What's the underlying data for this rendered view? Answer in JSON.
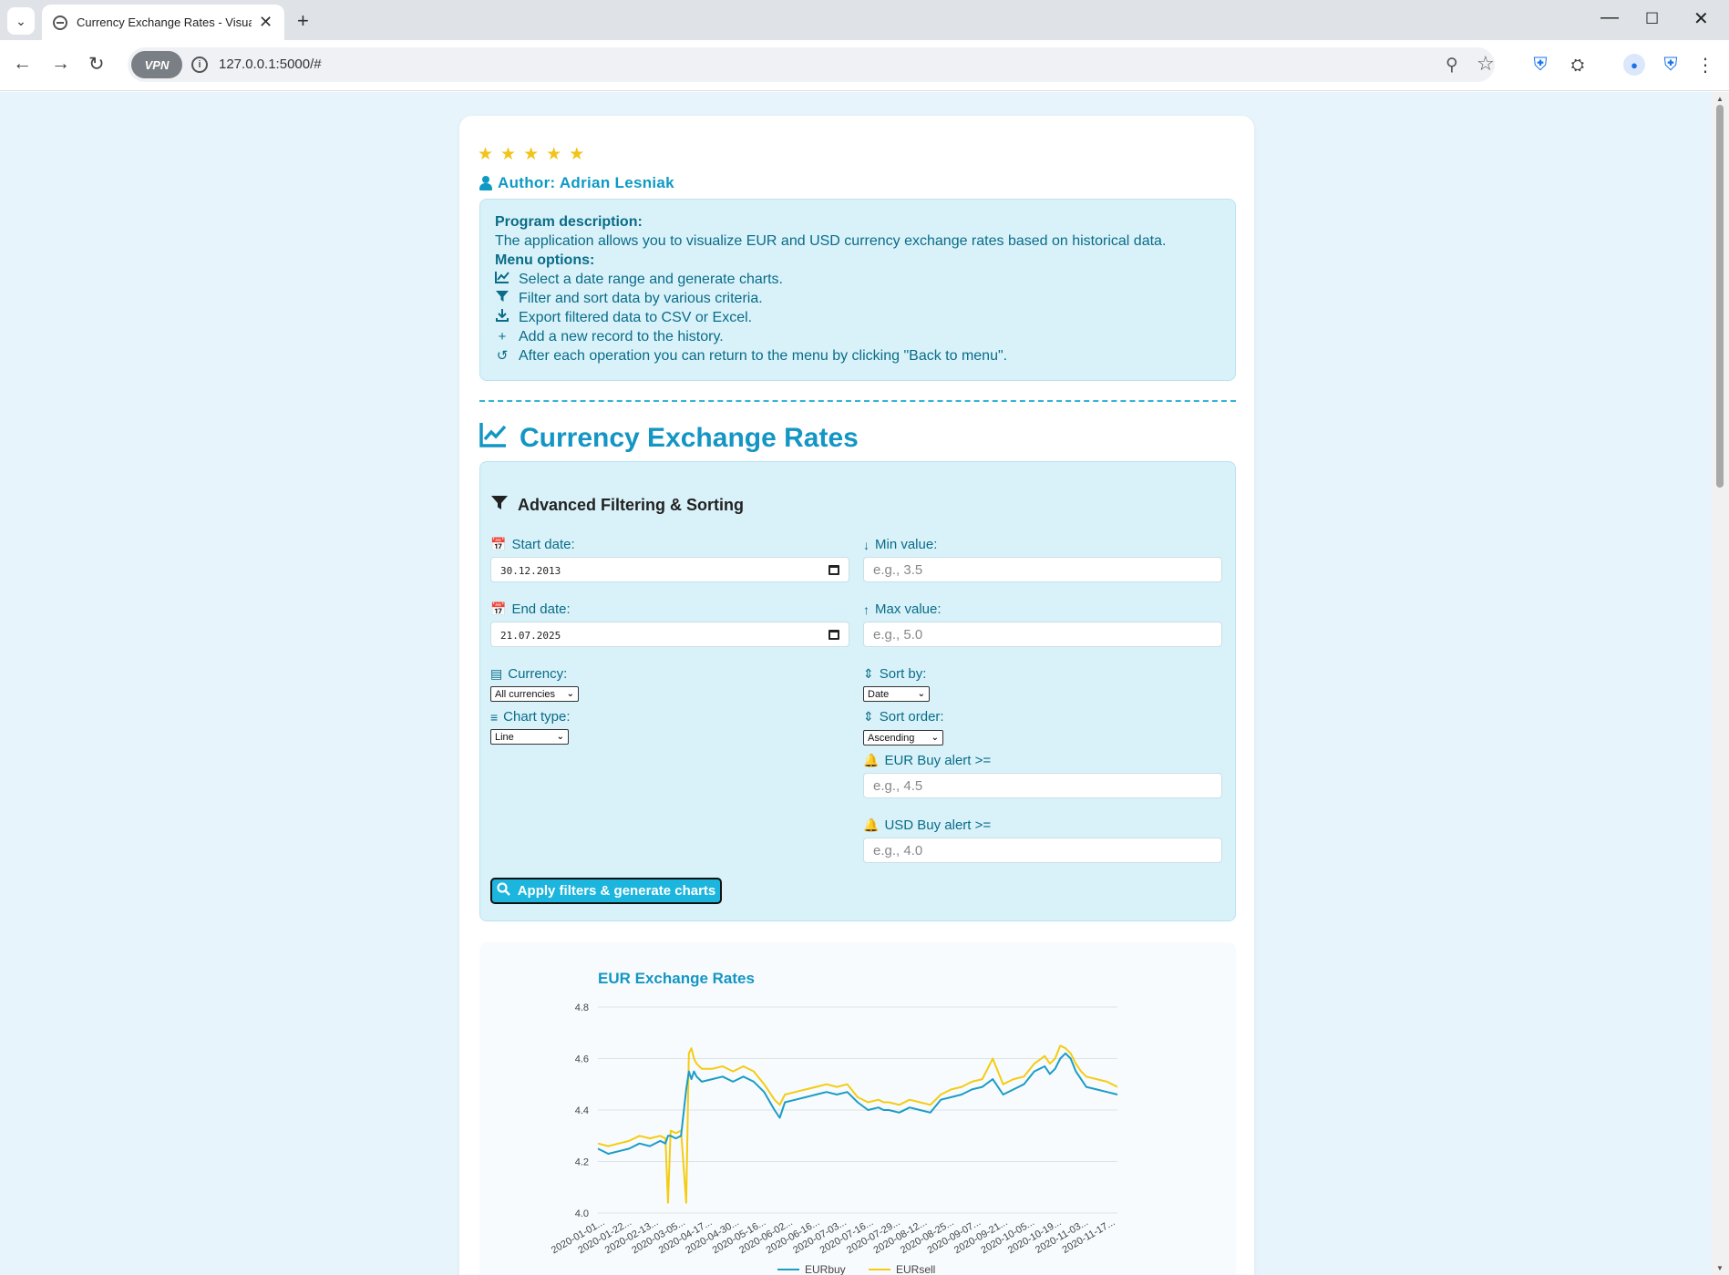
{
  "browser": {
    "tab_title": "Currency Exchange Rates - Visualiz",
    "url": "127.0.0.1:5000/#",
    "vpn_label": "VPN"
  },
  "rating": {
    "stars": 5,
    "max": 5
  },
  "author": "Author: Adrian Lesniak",
  "description": {
    "heading": "Program description:",
    "text": "The application allows you to visualize EUR and USD currency exchange rates based on historical data.",
    "menu_heading": "Menu options:",
    "items": [
      {
        "icon": "line-chart-icon",
        "text": "Select a date range and generate charts."
      },
      {
        "icon": "filter-icon",
        "text": "Filter and sort data by various criteria."
      },
      {
        "icon": "download-icon",
        "text": "Export filtered data to CSV or Excel."
      },
      {
        "icon": "plus-icon",
        "text": "Add a new record to the history."
      },
      {
        "icon": "undo-icon",
        "text": "After each operation you can return to the menu by clicking \"Back to menu\"."
      }
    ]
  },
  "main_title": "Currency Exchange Rates",
  "filters": {
    "title": "Advanced Filtering & Sorting",
    "start_date_label": "Start date:",
    "start_date_value": "30.12.2013",
    "end_date_label": "End date:",
    "end_date_value": "21.07.2025",
    "min_label": "Min value:",
    "min_placeholder": "e.g., 3.5",
    "max_label": "Max value:",
    "max_placeholder": "e.g., 5.0",
    "currency_label": "Currency:",
    "currency_value": "All currencies",
    "chart_type_label": "Chart type:",
    "chart_type_value": "Line",
    "sort_by_label": "Sort by:",
    "sort_by_value": "Date",
    "sort_order_label": "Sort order:",
    "sort_order_value": "Ascending",
    "eur_alert_label": "EUR Buy alert >=",
    "eur_alert_placeholder": "e.g., 4.5",
    "usd_alert_label": "USD Buy alert >=",
    "usd_alert_placeholder": "e.g., 4.0",
    "apply_label": "Apply filters & generate charts"
  },
  "colors": {
    "accent": "#1496c4",
    "eurbuy": "#1c9cc6",
    "eursell": "#f5cc12"
  },
  "chart_data": {
    "type": "line",
    "title": "EUR Exchange Rates",
    "ylim": [
      4.0,
      4.8
    ],
    "yticks": [
      "4.0",
      "4.2",
      "4.4",
      "4.6",
      "4.8"
    ],
    "grid": true,
    "legend_position": "bottom",
    "xtick_labels": [
      "2020-01-01...",
      "2020-01-22...",
      "2020-02-13...",
      "2020-03-05...",
      "2020-04-17...",
      "2020-04-30...",
      "2020-05-16...",
      "2020-06-02...",
      "2020-06-16...",
      "2020-07-03...",
      "2020-07-16...",
      "2020-07-29...",
      "2020-08-12...",
      "2020-08-25...",
      "2020-09-07...",
      "2020-09-21...",
      "2020-10-05...",
      "2020-10-19...",
      "2020-11-03...",
      "2020-11-17..."
    ],
    "x": [
      0,
      0.02,
      0.04,
      0.06,
      0.08,
      0.1,
      0.12,
      0.13,
      0.135,
      0.14,
      0.15,
      0.16,
      0.17,
      0.175,
      0.18,
      0.185,
      0.19,
      0.2,
      0.22,
      0.24,
      0.26,
      0.28,
      0.3,
      0.32,
      0.34,
      0.35,
      0.36,
      0.38,
      0.4,
      0.42,
      0.44,
      0.46,
      0.48,
      0.5,
      0.52,
      0.54,
      0.55,
      0.56,
      0.58,
      0.6,
      0.62,
      0.64,
      0.66,
      0.68,
      0.7,
      0.72,
      0.74,
      0.76,
      0.78,
      0.8,
      0.82,
      0.84,
      0.86,
      0.87,
      0.88,
      0.89,
      0.9,
      0.91,
      0.92,
      0.93,
      0.94,
      0.96,
      0.98,
      1.0
    ],
    "series": [
      {
        "name": "EURbuy",
        "values": [
          4.25,
          4.23,
          4.24,
          4.25,
          4.27,
          4.26,
          4.28,
          4.27,
          4.3,
          4.3,
          4.29,
          4.3,
          4.48,
          4.55,
          4.52,
          4.55,
          4.53,
          4.51,
          4.52,
          4.53,
          4.51,
          4.53,
          4.51,
          4.47,
          4.4,
          4.37,
          4.43,
          4.44,
          4.45,
          4.46,
          4.47,
          4.46,
          4.47,
          4.43,
          4.4,
          4.41,
          4.4,
          4.4,
          4.39,
          4.41,
          4.4,
          4.39,
          4.44,
          4.45,
          4.46,
          4.48,
          4.49,
          4.52,
          4.46,
          4.48,
          4.5,
          4.55,
          4.57,
          4.54,
          4.56,
          4.6,
          4.62,
          4.6,
          4.55,
          4.52,
          4.49,
          4.48,
          4.47,
          4.46
        ]
      },
      {
        "name": "EURsell",
        "values": [
          4.27,
          4.26,
          4.27,
          4.28,
          4.3,
          4.29,
          4.3,
          4.29,
          4.04,
          4.32,
          4.31,
          4.32,
          4.04,
          4.62,
          4.64,
          4.6,
          4.58,
          4.56,
          4.56,
          4.57,
          4.55,
          4.57,
          4.55,
          4.5,
          4.44,
          4.42,
          4.46,
          4.47,
          4.48,
          4.49,
          4.5,
          4.49,
          4.5,
          4.45,
          4.43,
          4.44,
          4.43,
          4.43,
          4.42,
          4.44,
          4.43,
          4.42,
          4.46,
          4.48,
          4.49,
          4.51,
          4.52,
          4.6,
          4.5,
          4.52,
          4.53,
          4.58,
          4.61,
          4.58,
          4.6,
          4.65,
          4.64,
          4.62,
          4.58,
          4.55,
          4.53,
          4.52,
          4.51,
          4.49
        ]
      }
    ]
  }
}
